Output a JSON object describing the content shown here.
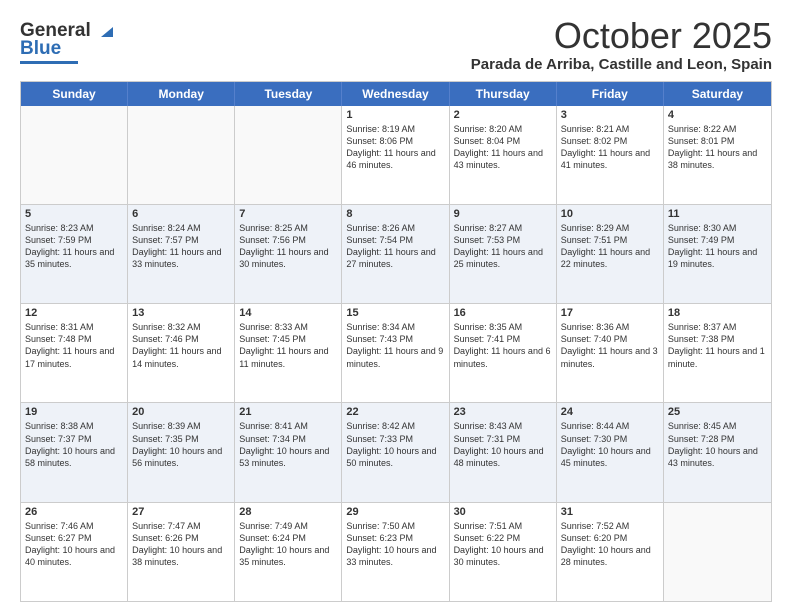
{
  "header": {
    "logo_general": "General",
    "logo_blue": "Blue",
    "title": "October 2025",
    "location": "Parada de Arriba, Castille and Leon, Spain"
  },
  "days_of_week": [
    "Sunday",
    "Monday",
    "Tuesday",
    "Wednesday",
    "Thursday",
    "Friday",
    "Saturday"
  ],
  "weeks": [
    {
      "alt": false,
      "cells": [
        {
          "day": "",
          "text": ""
        },
        {
          "day": "",
          "text": ""
        },
        {
          "day": "",
          "text": ""
        },
        {
          "day": "1",
          "text": "Sunrise: 8:19 AM\nSunset: 8:06 PM\nDaylight: 11 hours and 46 minutes."
        },
        {
          "day": "2",
          "text": "Sunrise: 8:20 AM\nSunset: 8:04 PM\nDaylight: 11 hours and 43 minutes."
        },
        {
          "day": "3",
          "text": "Sunrise: 8:21 AM\nSunset: 8:02 PM\nDaylight: 11 hours and 41 minutes."
        },
        {
          "day": "4",
          "text": "Sunrise: 8:22 AM\nSunset: 8:01 PM\nDaylight: 11 hours and 38 minutes."
        }
      ]
    },
    {
      "alt": true,
      "cells": [
        {
          "day": "5",
          "text": "Sunrise: 8:23 AM\nSunset: 7:59 PM\nDaylight: 11 hours and 35 minutes."
        },
        {
          "day": "6",
          "text": "Sunrise: 8:24 AM\nSunset: 7:57 PM\nDaylight: 11 hours and 33 minutes."
        },
        {
          "day": "7",
          "text": "Sunrise: 8:25 AM\nSunset: 7:56 PM\nDaylight: 11 hours and 30 minutes."
        },
        {
          "day": "8",
          "text": "Sunrise: 8:26 AM\nSunset: 7:54 PM\nDaylight: 11 hours and 27 minutes."
        },
        {
          "day": "9",
          "text": "Sunrise: 8:27 AM\nSunset: 7:53 PM\nDaylight: 11 hours and 25 minutes."
        },
        {
          "day": "10",
          "text": "Sunrise: 8:29 AM\nSunset: 7:51 PM\nDaylight: 11 hours and 22 minutes."
        },
        {
          "day": "11",
          "text": "Sunrise: 8:30 AM\nSunset: 7:49 PM\nDaylight: 11 hours and 19 minutes."
        }
      ]
    },
    {
      "alt": false,
      "cells": [
        {
          "day": "12",
          "text": "Sunrise: 8:31 AM\nSunset: 7:48 PM\nDaylight: 11 hours and 17 minutes."
        },
        {
          "day": "13",
          "text": "Sunrise: 8:32 AM\nSunset: 7:46 PM\nDaylight: 11 hours and 14 minutes."
        },
        {
          "day": "14",
          "text": "Sunrise: 8:33 AM\nSunset: 7:45 PM\nDaylight: 11 hours and 11 minutes."
        },
        {
          "day": "15",
          "text": "Sunrise: 8:34 AM\nSunset: 7:43 PM\nDaylight: 11 hours and 9 minutes."
        },
        {
          "day": "16",
          "text": "Sunrise: 8:35 AM\nSunset: 7:41 PM\nDaylight: 11 hours and 6 minutes."
        },
        {
          "day": "17",
          "text": "Sunrise: 8:36 AM\nSunset: 7:40 PM\nDaylight: 11 hours and 3 minutes."
        },
        {
          "day": "18",
          "text": "Sunrise: 8:37 AM\nSunset: 7:38 PM\nDaylight: 11 hours and 1 minute."
        }
      ]
    },
    {
      "alt": true,
      "cells": [
        {
          "day": "19",
          "text": "Sunrise: 8:38 AM\nSunset: 7:37 PM\nDaylight: 10 hours and 58 minutes."
        },
        {
          "day": "20",
          "text": "Sunrise: 8:39 AM\nSunset: 7:35 PM\nDaylight: 10 hours and 56 minutes."
        },
        {
          "day": "21",
          "text": "Sunrise: 8:41 AM\nSunset: 7:34 PM\nDaylight: 10 hours and 53 minutes."
        },
        {
          "day": "22",
          "text": "Sunrise: 8:42 AM\nSunset: 7:33 PM\nDaylight: 10 hours and 50 minutes."
        },
        {
          "day": "23",
          "text": "Sunrise: 8:43 AM\nSunset: 7:31 PM\nDaylight: 10 hours and 48 minutes."
        },
        {
          "day": "24",
          "text": "Sunrise: 8:44 AM\nSunset: 7:30 PM\nDaylight: 10 hours and 45 minutes."
        },
        {
          "day": "25",
          "text": "Sunrise: 8:45 AM\nSunset: 7:28 PM\nDaylight: 10 hours and 43 minutes."
        }
      ]
    },
    {
      "alt": false,
      "cells": [
        {
          "day": "26",
          "text": "Sunrise: 7:46 AM\nSunset: 6:27 PM\nDaylight: 10 hours and 40 minutes."
        },
        {
          "day": "27",
          "text": "Sunrise: 7:47 AM\nSunset: 6:26 PM\nDaylight: 10 hours and 38 minutes."
        },
        {
          "day": "28",
          "text": "Sunrise: 7:49 AM\nSunset: 6:24 PM\nDaylight: 10 hours and 35 minutes."
        },
        {
          "day": "29",
          "text": "Sunrise: 7:50 AM\nSunset: 6:23 PM\nDaylight: 10 hours and 33 minutes."
        },
        {
          "day": "30",
          "text": "Sunrise: 7:51 AM\nSunset: 6:22 PM\nDaylight: 10 hours and 30 minutes."
        },
        {
          "day": "31",
          "text": "Sunrise: 7:52 AM\nSunset: 6:20 PM\nDaylight: 10 hours and 28 minutes."
        },
        {
          "day": "",
          "text": ""
        }
      ]
    }
  ]
}
